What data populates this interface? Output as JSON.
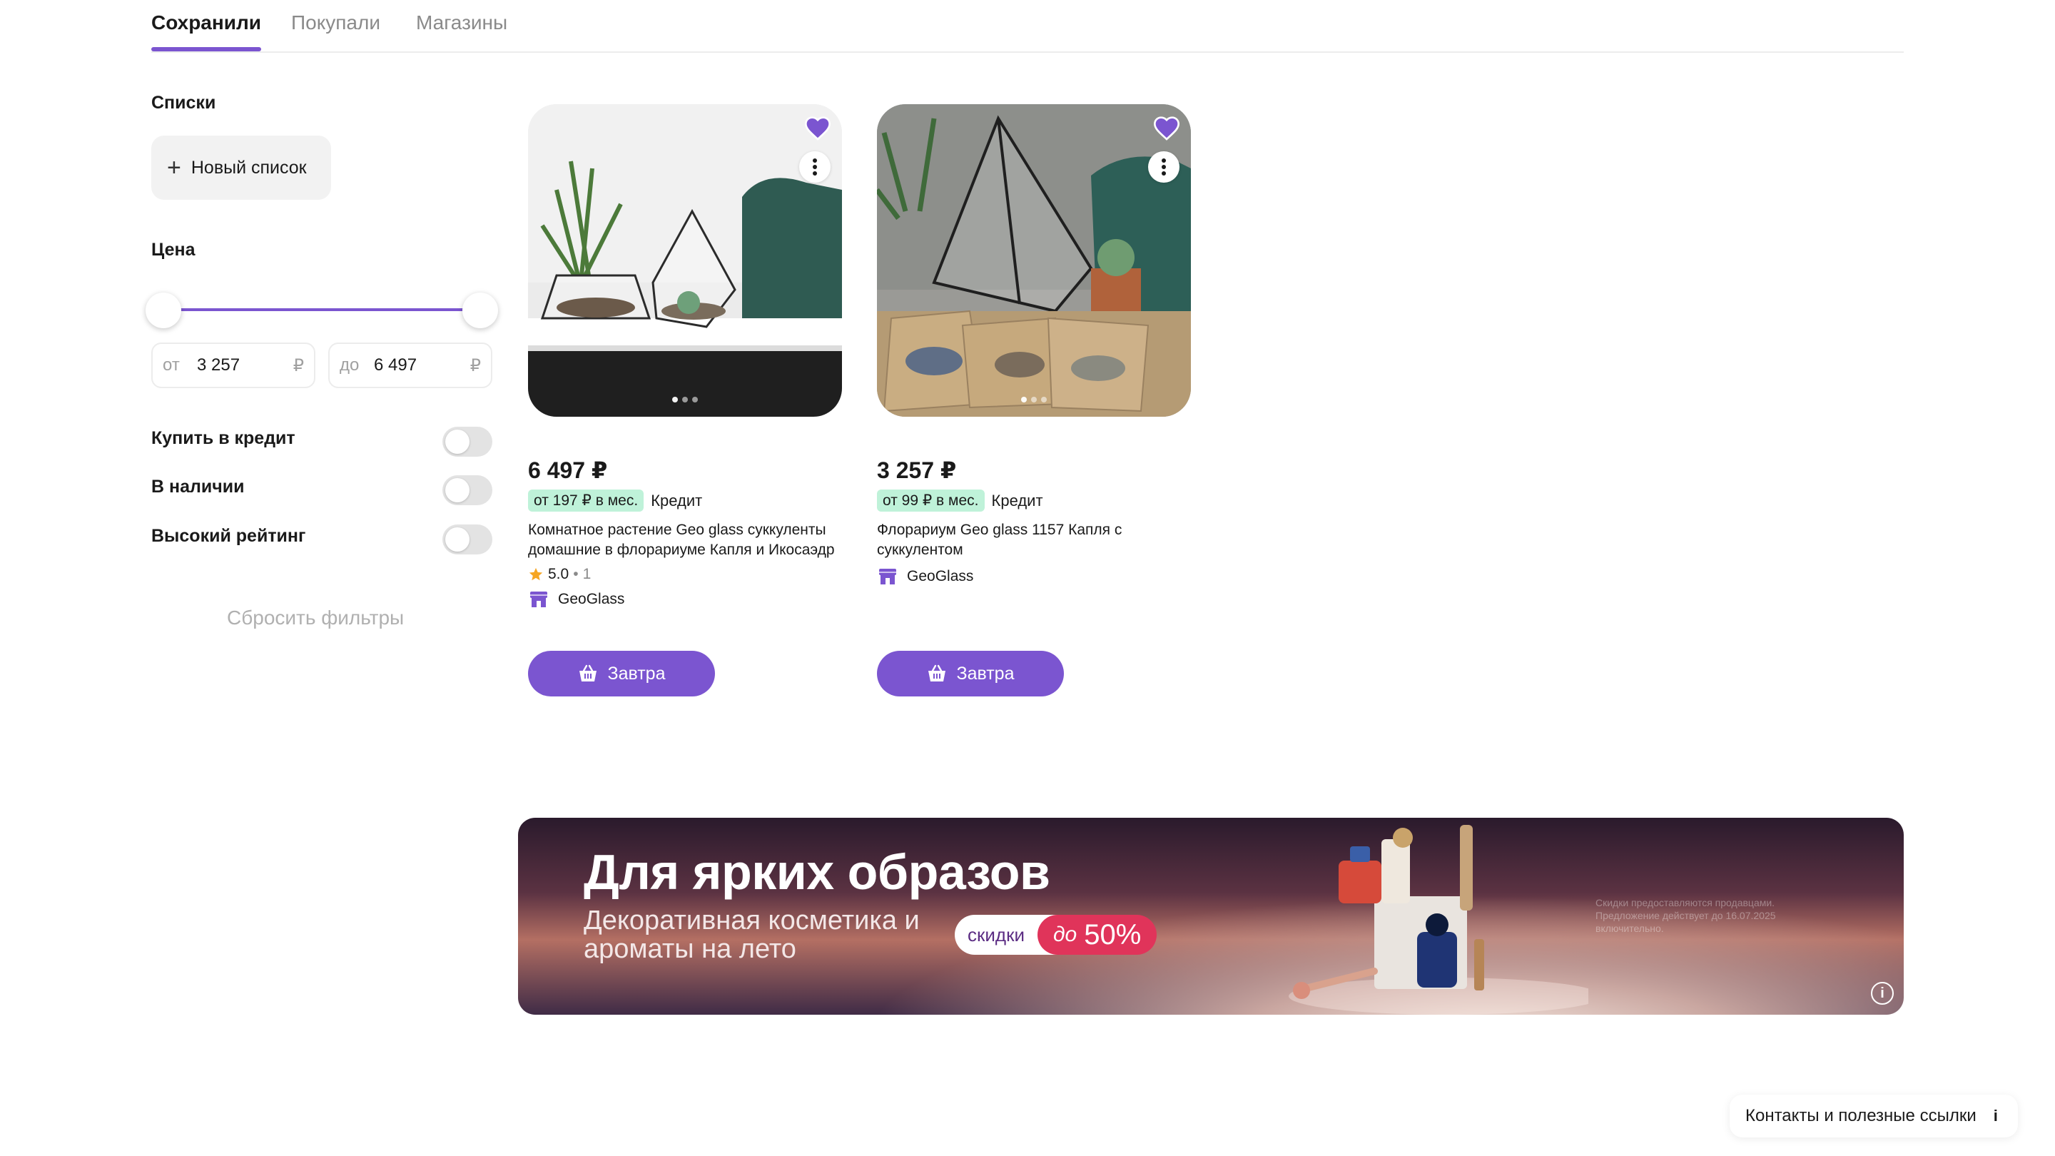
{
  "tabs": [
    {
      "label": "Сохранили",
      "active": true
    },
    {
      "label": "Покупали",
      "active": false
    },
    {
      "label": "Магазины",
      "active": false
    }
  ],
  "sidebar": {
    "lists_label": "Списки",
    "new_list_label": "Новый список",
    "price_label": "Цена",
    "price_from_prefix": "от",
    "price_from_value": "3 257",
    "price_to_prefix": "до",
    "price_to_value": "6 497",
    "currency": "₽",
    "toggles": [
      {
        "label": "Купить в кредит",
        "on": false
      },
      {
        "label": "В наличии",
        "on": false
      },
      {
        "label": "Высокий рейтинг",
        "on": false
      }
    ],
    "reset_label": "Сбросить фильтры"
  },
  "products": [
    {
      "price": "6 497 ₽",
      "credit_badge": "от 197 ₽ в мес.",
      "credit_label": "Кредит",
      "title": "Комнатное растение Geo glass суккуленты домашние в флорариуме Капля и Икосаэдр",
      "rating": "5.0",
      "rating_count": "1",
      "seller": "GeoGlass",
      "delivery_label": "Завтра",
      "favorited": true
    },
    {
      "price": "3 257 ₽",
      "credit_badge": "от 99 ₽ в мес.",
      "credit_label": "Кредит",
      "title": "Флорариум Geo glass 1157 Капля с суккулентом",
      "seller": "GeoGlass",
      "delivery_label": "Завтра",
      "favorited": true
    }
  ],
  "banner": {
    "title": "Для ярких образов",
    "subtitle": "Декоративная косметика и ароматы на лето",
    "discount_label": "скидки",
    "discount_prefix": "до",
    "discount_value": "50%",
    "legal": "Скидки предоставляются продавцами. Предложение действует до 16.07.2025 включительно."
  },
  "footer": {
    "contacts_label": "Контакты и полезные ссылки"
  },
  "colors": {
    "accent": "#7b55d0",
    "credit_badge_bg": "#bff2d9",
    "discount_red": "#e0345a"
  }
}
